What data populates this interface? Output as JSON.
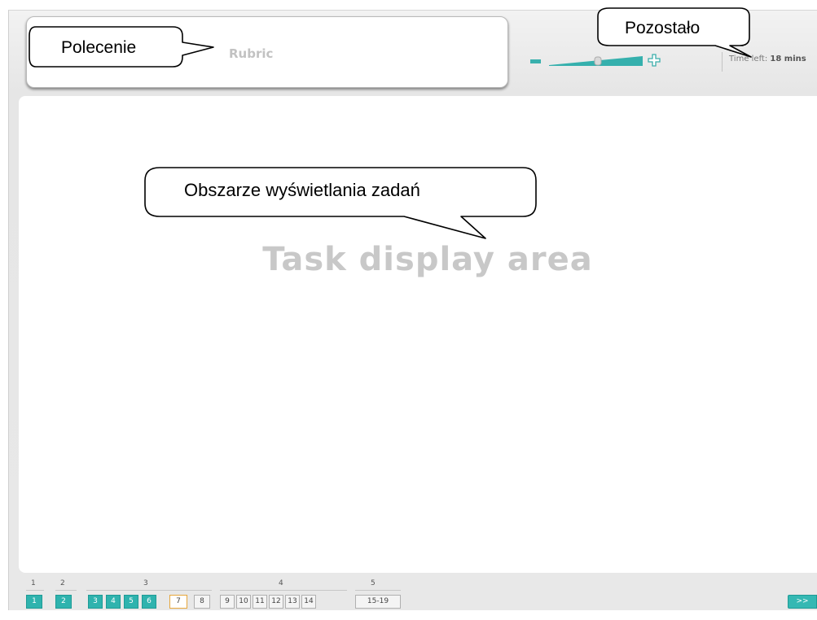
{
  "header": {
    "rubric_label": "Rubric",
    "time_left_label": "Time left:",
    "time_left_value": "18 mins"
  },
  "task_area": {
    "placeholder": "Task display area"
  },
  "callouts": {
    "rubric": "Polecenie",
    "time_left": "Pozostało",
    "task_area": "Obszarze wyświetlania zadań"
  },
  "navigation": {
    "sections": [
      "1",
      "2",
      "3",
      "4",
      "5"
    ],
    "questions": [
      {
        "label": "1",
        "state": "done"
      },
      {
        "label": "2",
        "state": "done"
      },
      {
        "label": "3",
        "state": "done"
      },
      {
        "label": "4",
        "state": "done"
      },
      {
        "label": "5",
        "state": "done"
      },
      {
        "label": "6",
        "state": "done"
      },
      {
        "label": "7",
        "state": "current"
      },
      {
        "label": "8",
        "state": "todo"
      },
      {
        "label": "9",
        "state": "todo"
      },
      {
        "label": "10",
        "state": "todo"
      },
      {
        "label": "11",
        "state": "todo"
      },
      {
        "label": "12",
        "state": "todo"
      },
      {
        "label": "13",
        "state": "todo"
      },
      {
        "label": "14",
        "state": "todo"
      },
      {
        "label": "15-19",
        "state": "todo"
      }
    ],
    "next_label": ">>"
  },
  "zoom": {
    "level": 0.6
  },
  "colors": {
    "accent": "#2fb3ae",
    "current_outline": "#e6a63c"
  }
}
